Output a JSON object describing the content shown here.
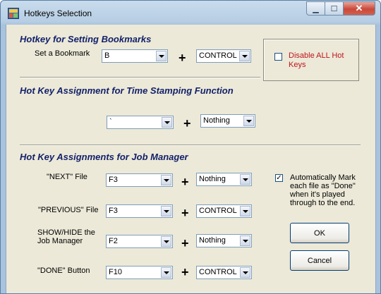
{
  "window": {
    "title": "Hotkeys Selection"
  },
  "bookmarks": {
    "title": "Hotkey for Setting Bookmarks",
    "label": "Set a Bookmark",
    "key": "B",
    "modifier": "CONTROL",
    "plus": "+"
  },
  "disable_all": {
    "label": "Disable ALL Hot Keys",
    "checked": false
  },
  "timestamp": {
    "title": "Hot Key Assignment for Time Stamping Function",
    "key": "`",
    "modifier": "Nothing",
    "plus": "+"
  },
  "job_manager": {
    "title": "Hot Key Assignments for Job Manager",
    "rows": [
      {
        "label": "\"NEXT\" File",
        "key": "F3",
        "modifier": "Nothing",
        "plus": "+"
      },
      {
        "label": "\"PREVIOUS\" File",
        "key": "F3",
        "modifier": "CONTROL",
        "plus": "+"
      },
      {
        "label_line1": "SHOW/HIDE the",
        "label_line2": "Job Manager",
        "key": "F2",
        "modifier": "Nothing",
        "plus": "+"
      },
      {
        "label": "\"DONE\" Button",
        "key": "F10",
        "modifier": "CONTROL",
        "plus": "+"
      }
    ],
    "auto_mark": {
      "checked": true,
      "check_glyph": "✓",
      "lines": [
        "Automatically Mark",
        "each file as \"Done\"",
        "when it's played",
        "through to the end."
      ]
    }
  },
  "buttons": {
    "ok": "OK",
    "cancel": "Cancel"
  },
  "caption_buttons": {
    "minimize": "▁",
    "maximize": "☐",
    "close": "✕"
  }
}
